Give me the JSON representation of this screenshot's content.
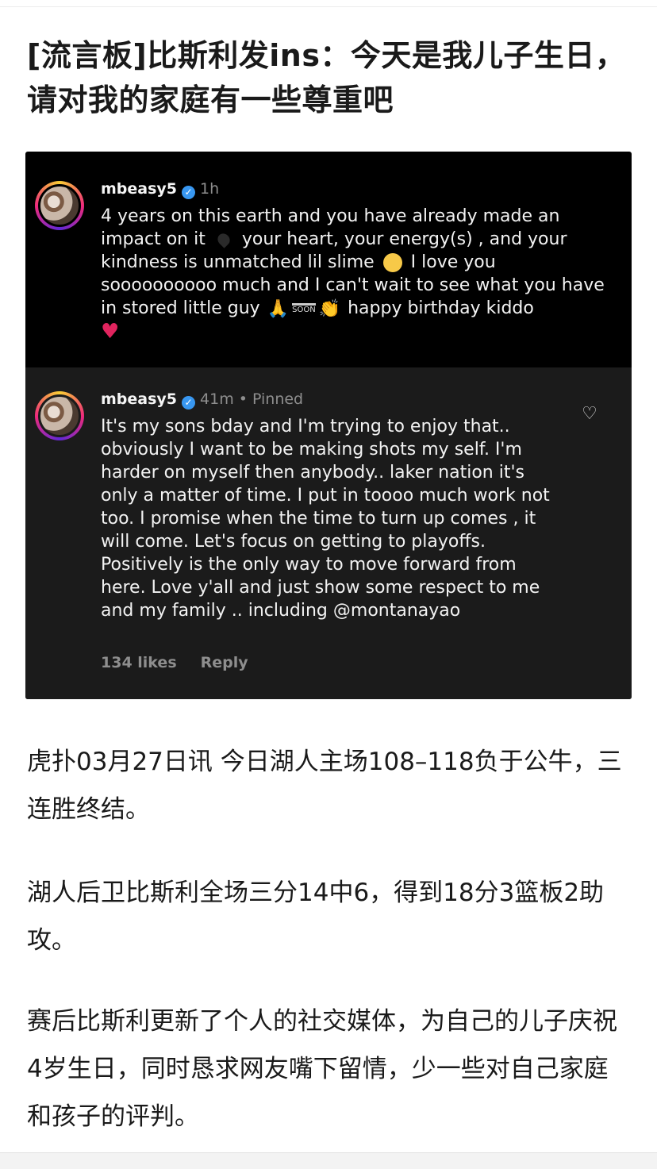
{
  "article": {
    "title": "[流言板]比斯利发ins：今天是我儿子生日，请对我的家庭有一些尊重吧",
    "paragraphs": [
      "虎扑03月27日讯 今日湖人主场108–118负于公牛，三连胜终结。",
      "湖人后卫比斯利全场三分14中6，得到18分3篮板2助攻。",
      "赛后比斯利更新了个人的社交媒体，为自己的儿子庆祝4岁生日，同时恳求网友嘴下留情，少一些对自己家庭和孩子的评判。"
    ]
  },
  "screenshot": {
    "post": {
      "username": "mbeasy5",
      "time": "1h",
      "text_1": "4 years on this earth and you have already made an impact on it",
      "text_2": "your heart, your energy(s) , and your kindness is unmatched lil slime",
      "text_3": "I love you soooooooooo much and I can't wait to see what you have in stored little guy",
      "soon_label": "SOON",
      "text_4": "happy birthday kiddo",
      "emoji_icons": [
        "black-heart-icon",
        "pleading-face-icon",
        "folded-hands-icon",
        "soon-arrow-icon",
        "clapping-hands-icon",
        "red-heart-icon"
      ]
    },
    "comment": {
      "username": "mbeasy5",
      "time": "41m",
      "pinned": "• Pinned",
      "text": "It's my sons bday and I'm trying to enjoy that.. obviously I want to be making shots my self. I'm harder on myself then anybody.. laker nation it's only a matter of time. I put in toooo much work not too. I promise when the time to turn up comes , it will come. Let's focus on getting to playoffs. Positively is the only way to move forward from here. Love y'all and just show some respect to me and my family .. including @montanayao",
      "likes": "134 likes",
      "reply": "Reply"
    }
  }
}
